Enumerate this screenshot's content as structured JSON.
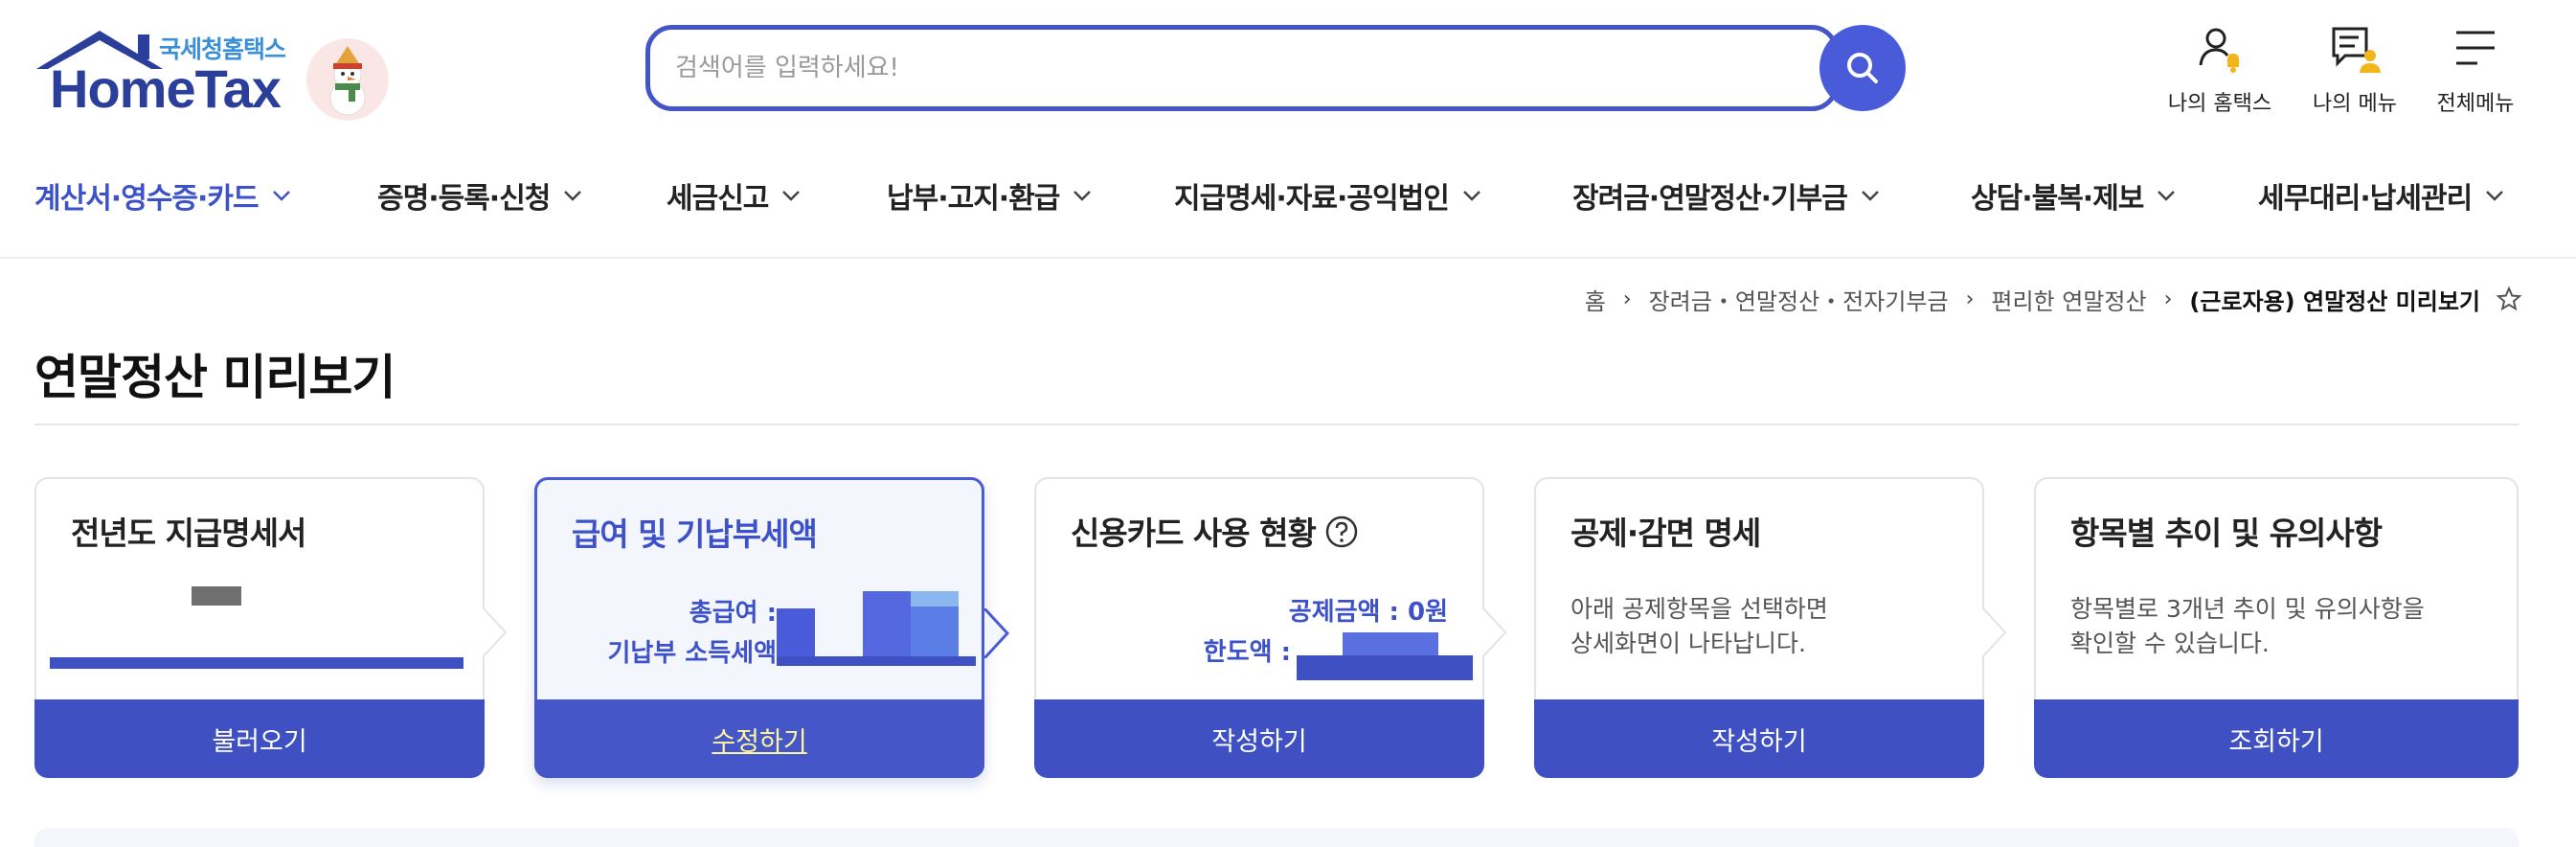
{
  "header": {
    "logo_tagline": "국세청홈택스",
    "logo_brand": "HomeTax",
    "search_placeholder": "검색어를 입력하세요!",
    "utils": [
      {
        "label": "나의 홈택스",
        "icon": "my-hometax-icon"
      },
      {
        "label": "나의 메뉴",
        "icon": "my-menu-icon"
      },
      {
        "label": "전체메뉴",
        "icon": "hamburger-menu-icon"
      }
    ]
  },
  "nav": {
    "items": [
      {
        "label": "계산서·영수증·카드",
        "active": true
      },
      {
        "label": "증명·등록·신청"
      },
      {
        "label": "세금신고"
      },
      {
        "label": "납부·고지·환급"
      },
      {
        "label": "지급명세·자료·공익법인"
      },
      {
        "label": "장려금·연말정산·기부금"
      },
      {
        "label": "상담·불복·제보"
      },
      {
        "label": "세무대리·납세관리"
      }
    ]
  },
  "breadcrumb": {
    "items": [
      "홈",
      "장려금・연말정산・전자기부금",
      "편리한 연말정산",
      "(근로자용) 연말정산 미리보기"
    ],
    "separator": "›"
  },
  "page": {
    "title": "연말정산 미리보기"
  },
  "cards": [
    {
      "title": "전년도 지급명세서",
      "button": "불러오기"
    },
    {
      "title": "급여 및 기납부세액",
      "label_total_pay": "총급여 :",
      "label_prepaid_tax": "기납부 소득세액",
      "button": "수정하기",
      "active": true
    },
    {
      "title": "신용카드 사용 현황",
      "label_deduction": "공제금액 : 0원",
      "label_limit": "한도액 :",
      "button": "작성하기"
    },
    {
      "title": "공제·감면 명세",
      "desc_line1": "아래 공제항목을 선택하면",
      "desc_line2": "상세화면이 나타납니다.",
      "button": "작성하기"
    },
    {
      "title": "항목별 추이 및 유의사항",
      "desc_line1": "항목별로 3개년 추이 및 유의사항을",
      "desc_line2": "확인할 수 있습니다.",
      "button": "조회하기"
    }
  ],
  "colors": {
    "primary": "#3f51c2",
    "accent": "#4a5bd9",
    "active_text": "#3d52c9",
    "active_button_text": "#fff59a"
  }
}
